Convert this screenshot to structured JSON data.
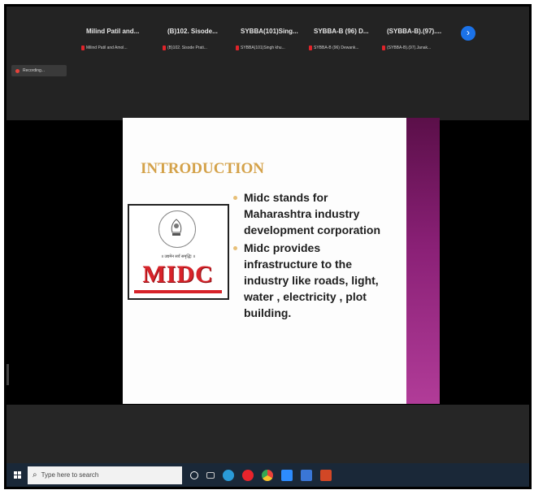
{
  "participants": [
    {
      "name": "Milind Patil and...",
      "sub": "Milind Patil and Amol..."
    },
    {
      "name": "(B)102.  Sisode...",
      "sub": "(B)102.  Sisode Prati..."
    },
    {
      "name": "SYBBA(101)Sing...",
      "sub": "SYBBA(101)Singh khu..."
    },
    {
      "name": "SYBBA-B (96) D...",
      "sub": "SYBBA-B (96) Dewank..."
    },
    {
      "name": "(SYBBA-B).(97)....",
      "sub": "(SYBBA-B).(97).Janak..."
    }
  ],
  "next_glyph": "›",
  "recording_label": "Recording...",
  "slide": {
    "title": "INTRODUCTION",
    "logo_text": "MIDC",
    "seal_motto": "॥ उद्यमेन सर्वं समृद्धिः ॥",
    "bullets": [
      "Midc stands for Maharashtra industry development corporation",
      "Midc provides infrastructure to the industry like roads, light, water , electricity , plot building."
    ]
  },
  "taskbar": {
    "search_placeholder": "Type here to search",
    "icons": [
      "task-view-icon",
      "cortana-icon",
      "edge-icon",
      "opera-icon",
      "chrome-icon",
      "zoom-icon",
      "store-icon",
      "powerpoint-icon"
    ]
  },
  "colors": {
    "accent": "#1b72e8",
    "slide_bar": "#8a2076",
    "title": "#d4a24a",
    "logo_red": "#d7232a"
  }
}
